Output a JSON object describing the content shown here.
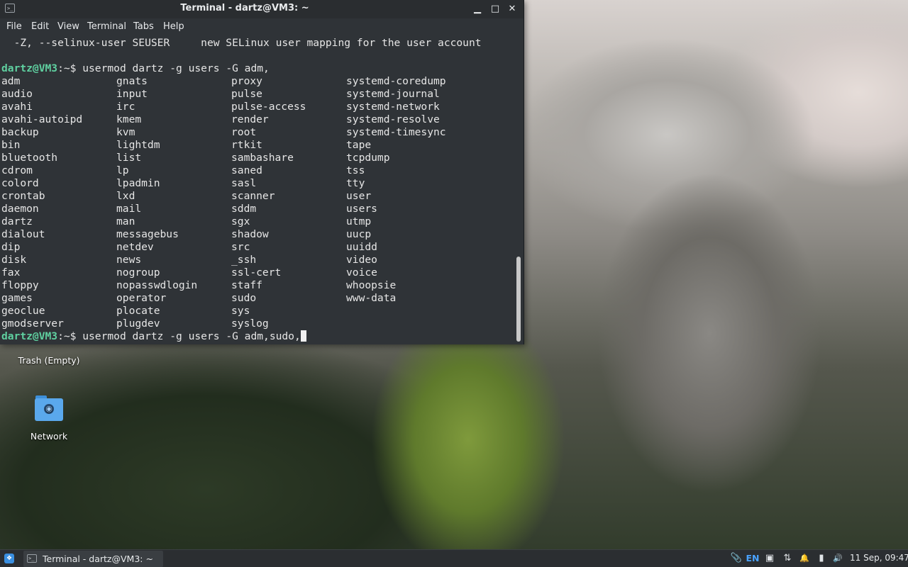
{
  "terminal": {
    "title": "Terminal - dartz@VM3: ~",
    "title_icon": ">_",
    "controls": {
      "minimize": "▁",
      "maximize": "□",
      "close": "✕"
    },
    "menu": [
      "File",
      "Edit",
      "View",
      "Terminal",
      "Tabs",
      "Help"
    ],
    "help_line": "  -Z, --selinux-user SEUSER     new SELinux user mapping for the user account",
    "prompt_user": "dartz@VM3",
    "prompt_suffix": ":~$ ",
    "command1": "usermod dartz -g users -G adm,",
    "command2": "usermod dartz -g users -G adm,sudo,",
    "completions": [
      [
        "adm",
        "gnats",
        "proxy",
        "systemd-coredump"
      ],
      [
        "audio",
        "input",
        "pulse",
        "systemd-journal"
      ],
      [
        "avahi",
        "irc",
        "pulse-access",
        "systemd-network"
      ],
      [
        "avahi-autoipd",
        "kmem",
        "render",
        "systemd-resolve"
      ],
      [
        "backup",
        "kvm",
        "root",
        "systemd-timesync"
      ],
      [
        "bin",
        "lightdm",
        "rtkit",
        "tape"
      ],
      [
        "bluetooth",
        "list",
        "sambashare",
        "tcpdump"
      ],
      [
        "cdrom",
        "lp",
        "saned",
        "tss"
      ],
      [
        "colord",
        "lpadmin",
        "sasl",
        "tty"
      ],
      [
        "crontab",
        "lxd",
        "scanner",
        "user"
      ],
      [
        "daemon",
        "mail",
        "sddm",
        "users"
      ],
      [
        "dartz",
        "man",
        "sgx",
        "utmp"
      ],
      [
        "dialout",
        "messagebus",
        "shadow",
        "uucp"
      ],
      [
        "dip",
        "netdev",
        "src",
        "uuidd"
      ],
      [
        "disk",
        "news",
        "_ssh",
        "video"
      ],
      [
        "fax",
        "nogroup",
        "ssl-cert",
        "voice"
      ],
      [
        "floppy",
        "nopasswdlogin",
        "staff",
        "whoopsie"
      ],
      [
        "games",
        "operator",
        "sudo",
        "www-data"
      ],
      [
        "geoclue",
        "plocate",
        "sys",
        ""
      ],
      [
        "gmodserver",
        "plugdev",
        "syslog",
        ""
      ]
    ]
  },
  "desktop_icons": [
    {
      "label": "Trash (Empty)",
      "icon": "trash-icon"
    },
    {
      "label": "Network",
      "icon": "network-folder-icon"
    }
  ],
  "taskbar": {
    "start_icon": "❖",
    "task_label": "Terminal - dartz@VM3: ~",
    "tray": {
      "clip": "📎",
      "lang": "EN",
      "display": "▣",
      "network": "⇅",
      "bell": "🔔",
      "battery": "▮",
      "volume": "🔊"
    },
    "clock": "11 Sep, 09:47"
  }
}
